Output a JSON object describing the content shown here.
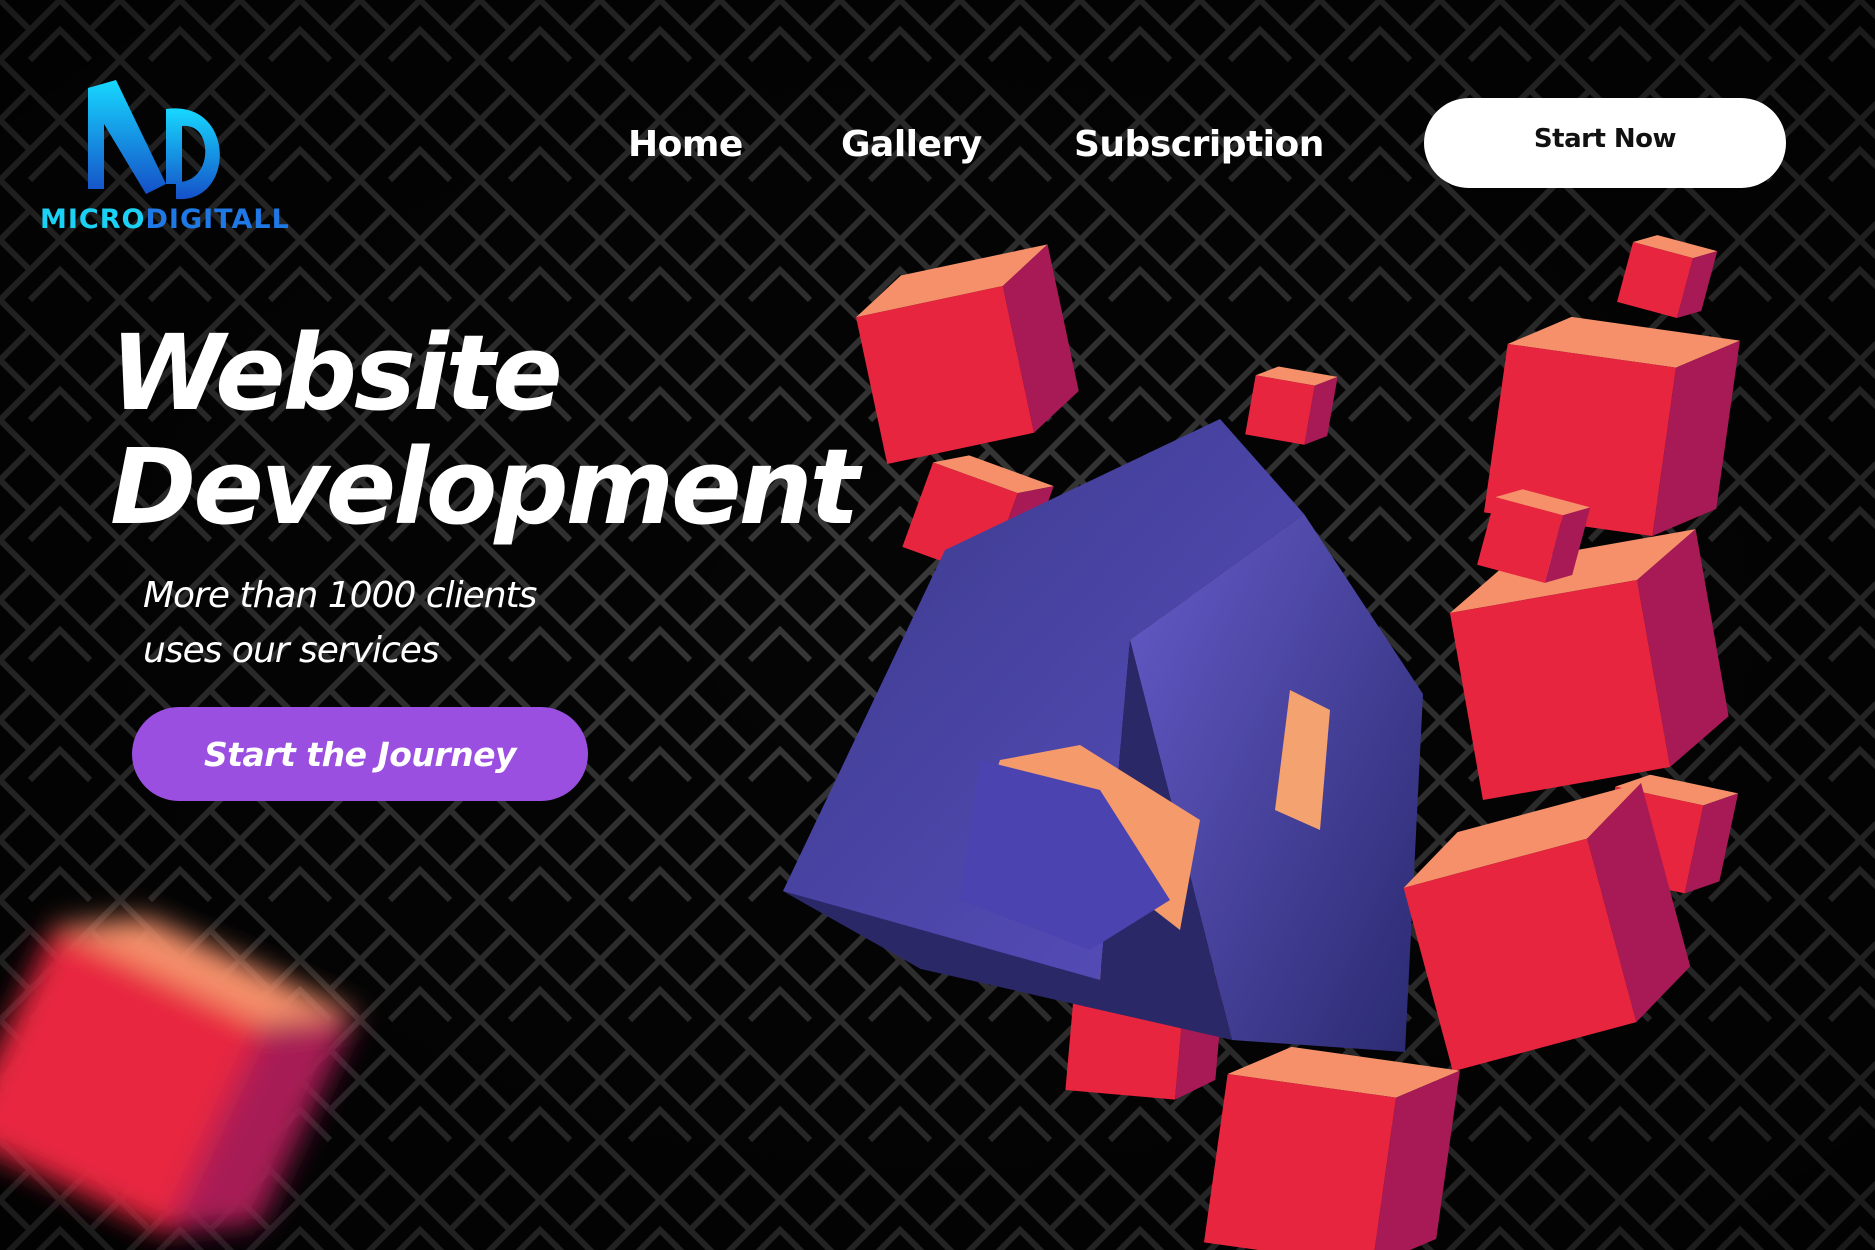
{
  "brand": {
    "name_part1": "MICRO",
    "name_part2": "DIGITALL",
    "logo_colors": [
      "#1ad2f5",
      "#1e78e6"
    ]
  },
  "nav": {
    "items": [
      {
        "label": "Home"
      },
      {
        "label": "Gallery"
      },
      {
        "label": "Subscription"
      }
    ],
    "cta_label": "Start Now"
  },
  "hero": {
    "title_line1": "Website",
    "title_line2": "Development",
    "subtitle_line1": "More than 1000 clients",
    "subtitle_line2": "uses our services",
    "cta_label": "Start the Journey",
    "cta_color": "#9b4fe0"
  },
  "colors": {
    "background": "#0a0a0a",
    "pattern_lines": "#3a3a3a",
    "cube_red": "#e8253f",
    "cube_blue": "#4a3fa0"
  }
}
